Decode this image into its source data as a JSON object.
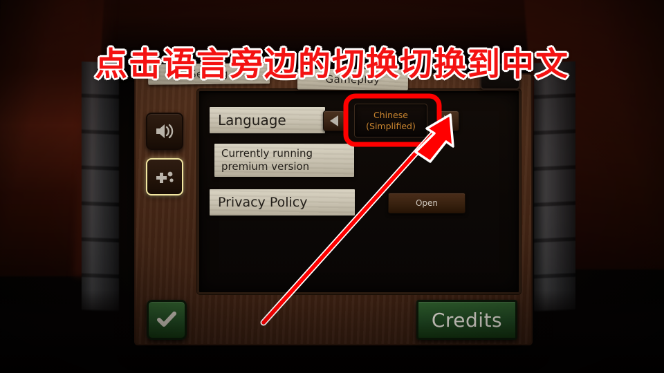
{
  "annotation": {
    "instruction_text": "点击语言旁边的切换切换到中文",
    "instruction_color": "#f41212",
    "highlight_color": "#ff0000",
    "highlight_target": "language-value-box",
    "arrow_points_to": "language-next-arrow-button"
  },
  "tabs": [
    {
      "id": "tab-settings",
      "label": "Setting"
    },
    {
      "id": "tab-gameplay",
      "label": "Gameplay"
    },
    {
      "id": "tab-extra",
      "label": ""
    }
  ],
  "sidebar": {
    "items": [
      {
        "id": "audio",
        "icon": "speaker-icon",
        "selected": false
      },
      {
        "id": "misc",
        "icon": "plus-dots-icon",
        "selected": true
      }
    ],
    "selected_outline_color": "#f2e6a0"
  },
  "settings": {
    "rows": [
      {
        "id": "language",
        "label": "Language",
        "prev_arrow": "◀",
        "next_arrow": "▶",
        "value_line1": "Chinese",
        "value_line2": "(Simplified)",
        "value_color": "#c9852f"
      },
      {
        "id": "premium-status",
        "label_line1": "Currently running",
        "label_line2": "premium version"
      },
      {
        "id": "privacy-policy",
        "label": "Privacy Policy",
        "button_label": "Open"
      }
    ]
  },
  "footer": {
    "confirm_icon": "checkmark-icon",
    "confirm_glyph": "✔",
    "credits_label": "Credits",
    "button_color": "#1f4420"
  }
}
